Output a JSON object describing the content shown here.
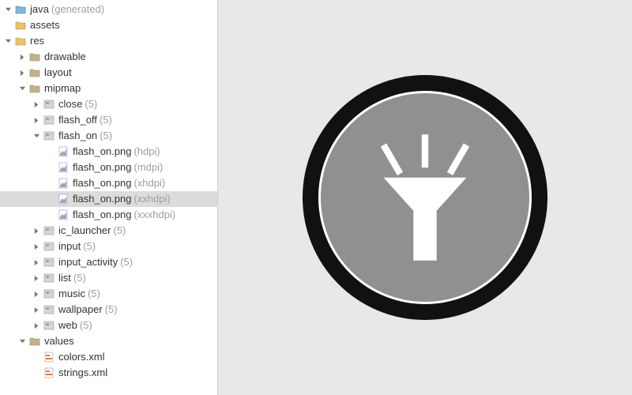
{
  "tree": [
    {
      "depth": 0,
      "arrow": "down",
      "icon": "java-folder",
      "label": "java",
      "qual": "(generated)"
    },
    {
      "depth": 0,
      "arrow": "none",
      "icon": "res-folder",
      "label": "assets"
    },
    {
      "depth": 0,
      "arrow": "down",
      "icon": "res-folder",
      "label": "res"
    },
    {
      "depth": 1,
      "arrow": "right",
      "icon": "folder",
      "label": "drawable"
    },
    {
      "depth": 1,
      "arrow": "right",
      "icon": "folder",
      "label": "layout"
    },
    {
      "depth": 1,
      "arrow": "down",
      "icon": "folder",
      "label": "mipmap"
    },
    {
      "depth": 2,
      "arrow": "right",
      "icon": "image-set",
      "label": "close",
      "qual": "(5)"
    },
    {
      "depth": 2,
      "arrow": "right",
      "icon": "image-set",
      "label": "flash_off",
      "qual": "(5)"
    },
    {
      "depth": 2,
      "arrow": "down",
      "icon": "image-set",
      "label": "flash_on",
      "qual": "(5)"
    },
    {
      "depth": 3,
      "arrow": "none",
      "icon": "image-file",
      "label": "flash_on.png",
      "qual": "(hdpi)"
    },
    {
      "depth": 3,
      "arrow": "none",
      "icon": "image-file",
      "label": "flash_on.png",
      "qual": "(mdpi)"
    },
    {
      "depth": 3,
      "arrow": "none",
      "icon": "image-file",
      "label": "flash_on.png",
      "qual": "(xhdpi)"
    },
    {
      "depth": 3,
      "arrow": "none",
      "icon": "image-file",
      "label": "flash_on.png",
      "qual": "(xxhdpi)",
      "selected": true
    },
    {
      "depth": 3,
      "arrow": "none",
      "icon": "image-file",
      "label": "flash_on.png",
      "qual": "(xxxhdpi)"
    },
    {
      "depth": 2,
      "arrow": "right",
      "icon": "image-set",
      "label": "ic_launcher",
      "qual": "(5)"
    },
    {
      "depth": 2,
      "arrow": "right",
      "icon": "image-set",
      "label": "input",
      "qual": "(5)"
    },
    {
      "depth": 2,
      "arrow": "right",
      "icon": "image-set",
      "label": "input_activity",
      "qual": "(5)"
    },
    {
      "depth": 2,
      "arrow": "right",
      "icon": "image-set",
      "label": "list",
      "qual": "(5)"
    },
    {
      "depth": 2,
      "arrow": "right",
      "icon": "image-set",
      "label": "music",
      "qual": "(5)"
    },
    {
      "depth": 2,
      "arrow": "right",
      "icon": "image-set",
      "label": "wallpaper",
      "qual": "(5)"
    },
    {
      "depth": 2,
      "arrow": "right",
      "icon": "image-set",
      "label": "web",
      "qual": "(5)"
    },
    {
      "depth": 1,
      "arrow": "down",
      "icon": "folder",
      "label": "values"
    },
    {
      "depth": 2,
      "arrow": "none",
      "icon": "xml-file",
      "label": "colors.xml"
    },
    {
      "depth": 2,
      "arrow": "none",
      "icon": "xml-file",
      "label": "strings.xml"
    }
  ],
  "preview": {
    "alt": "flash_on icon"
  }
}
